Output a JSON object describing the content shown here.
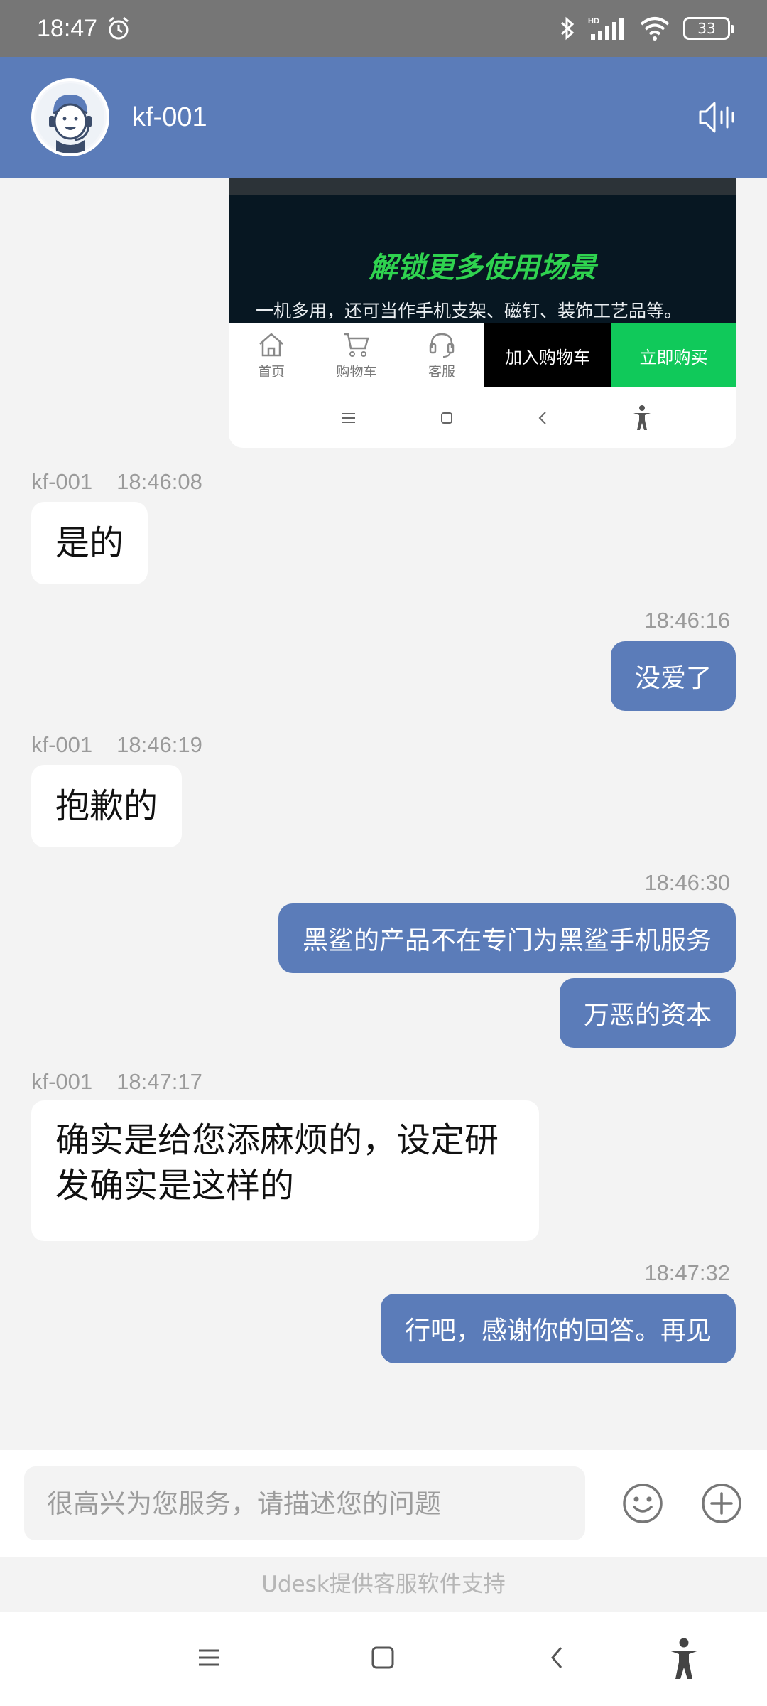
{
  "status_bar": {
    "time": "18:47",
    "battery": "33",
    "network": "HD"
  },
  "header": {
    "agent_name": "kf-001"
  },
  "product_card": {
    "banner_title": "解锁更多使用场景",
    "banner_subtitle": "一机多用，还可当作手机支架、磁钉、装饰工艺品等。",
    "nav_home": "首页",
    "nav_cart": "购物车",
    "nav_service": "客服",
    "add_to_cart": "加入购物车",
    "buy_now": "立即购买"
  },
  "messages": [
    {
      "from": "agent",
      "sender": "kf-001",
      "time": "18:46:08",
      "text": "是的"
    },
    {
      "from": "user",
      "time": "18:46:16",
      "text": "没爱了"
    },
    {
      "from": "agent",
      "sender": "kf-001",
      "time": "18:46:19",
      "text": "抱歉的"
    },
    {
      "from": "user",
      "time": "18:46:30",
      "text": "黑鲨的产品不在专门为黑鲨手机服务"
    },
    {
      "from": "user",
      "time": "",
      "text": "万恶的资本"
    },
    {
      "from": "agent",
      "sender": "kf-001",
      "time": "18:47:17",
      "text": "确实是给您添麻烦的，设定研发确实是这样的"
    },
    {
      "from": "user",
      "time": "18:47:32",
      "text": "行吧，感谢你的回答。再见"
    }
  ],
  "input": {
    "placeholder": "很高兴为您服务，请描述您的问题"
  },
  "footer": {
    "powered_by": "Udesk提供客服软件支持"
  },
  "colors": {
    "header": "#5b7cb9",
    "user_bubble": "#5b7cb9",
    "status_bar": "#767676",
    "buy_button": "#10c95a"
  },
  "icons": [
    "alarm-icon",
    "bluetooth-icon",
    "signal-icon",
    "wifi-icon",
    "battery-icon",
    "speaker-icon",
    "emoji-icon",
    "plus-icon",
    "menu-icon",
    "home-icon",
    "back-icon",
    "accessibility-icon"
  ]
}
